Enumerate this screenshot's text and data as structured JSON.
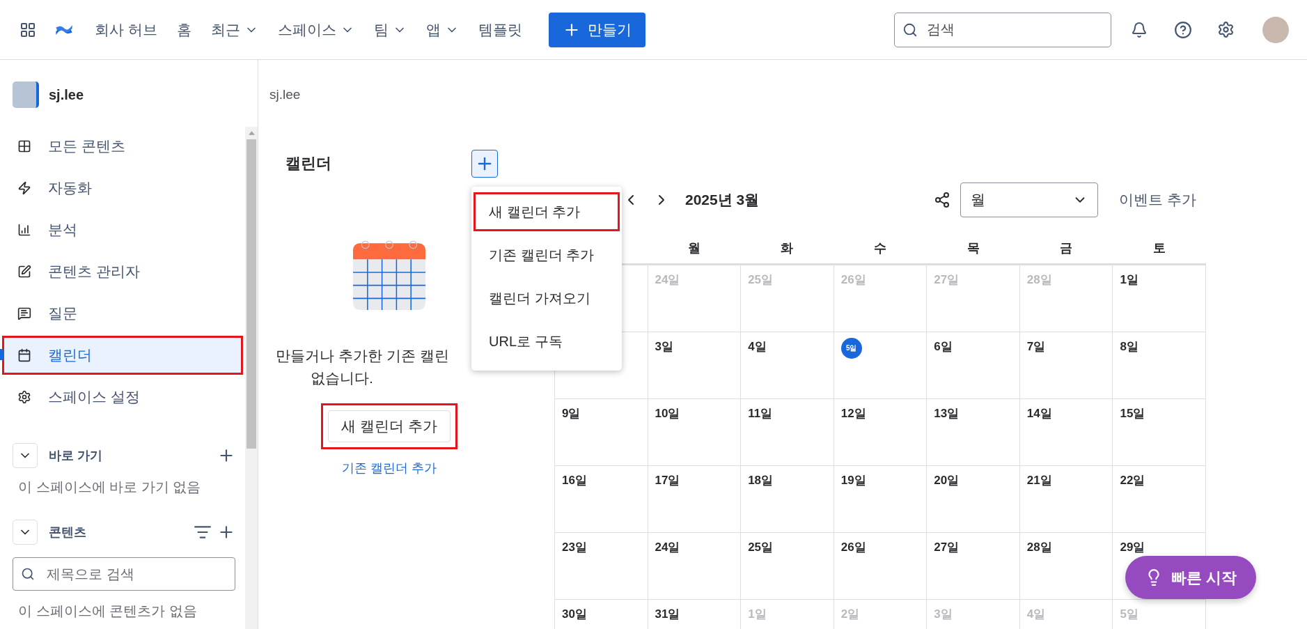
{
  "top_nav": {
    "items": [
      {
        "label": "회사 허브",
        "dropdown": false
      },
      {
        "label": "홈",
        "dropdown": false
      },
      {
        "label": "최근",
        "dropdown": true
      },
      {
        "label": "스페이스",
        "dropdown": true
      },
      {
        "label": "팀",
        "dropdown": true
      },
      {
        "label": "앱",
        "dropdown": true
      },
      {
        "label": "템플릿",
        "dropdown": false
      }
    ],
    "create_button": "만들기",
    "search": {
      "placeholder": "검색"
    }
  },
  "sidebar": {
    "space_name": "sj.lee",
    "items": [
      {
        "label": "모든 콘텐츠",
        "selected": false,
        "highlighted": false
      },
      {
        "label": "자동화",
        "selected": false,
        "highlighted": false
      },
      {
        "label": "분석",
        "selected": false,
        "highlighted": false
      },
      {
        "label": "콘텐츠 관리자",
        "selected": false,
        "highlighted": false
      },
      {
        "label": "질문",
        "selected": false,
        "highlighted": false
      },
      {
        "label": "캘린더",
        "selected": true,
        "highlighted": true
      },
      {
        "label": "스페이스 설정",
        "selected": false,
        "highlighted": false
      }
    ],
    "shortcuts": {
      "title": "바로 가기",
      "empty": "이 스페이스에 바로 가기 없음"
    },
    "content": {
      "title": "콘텐츠",
      "search_placeholder": "제목으로 검색",
      "empty": "이 스페이스에 콘텐츠가 없음"
    }
  },
  "breadcrumb": "sj.lee",
  "calendars": {
    "title": "캘린더",
    "add_menu": [
      {
        "label": "새 캘린더 추가",
        "highlighted": true
      },
      {
        "label": "기존 캘린더 추가",
        "highlighted": false
      },
      {
        "label": "캘린더 가져오기",
        "highlighted": false
      },
      {
        "label": "URL로 구독",
        "highlighted": false
      }
    ],
    "empty_message": [
      "만들거나 추가한 기존 캘린",
      "없습니다."
    ],
    "new_button": {
      "label": "새 캘린더 추가",
      "highlighted": true
    },
    "existing_link": "기존 캘린더 추가"
  },
  "calendar": {
    "month": "2025년 3월",
    "view": "월",
    "add_event": "이벤트 추가",
    "weekdays": [
      {
        "label": "월"
      },
      {
        "label": "화"
      },
      {
        "label": "수"
      },
      {
        "label": "목"
      },
      {
        "label": "금"
      },
      {
        "label": "토"
      }
    ],
    "weeks": [
      [
        {
          "day": "24일",
          "muted": true
        },
        {
          "day": "25일",
          "muted": true
        },
        {
          "day": "26일",
          "muted": true
        },
        {
          "day": "27일",
          "muted": true
        },
        {
          "day": "28일",
          "muted": true
        },
        {
          "day": "1일",
          "muted": false
        }
      ],
      [
        {
          "day": "3일",
          "muted": false
        },
        {
          "day": "4일",
          "muted": false
        },
        {
          "day": "5일",
          "today": true
        },
        {
          "day": "6일",
          "muted": false
        },
        {
          "day": "7일",
          "muted": false
        },
        {
          "day": "8일",
          "muted": false
        }
      ],
      [
        {
          "day": "9일",
          "muted": false
        },
        {
          "day": "10일",
          "muted": false
        },
        {
          "day": "11일",
          "muted": false
        },
        {
          "day": "12일",
          "muted": false
        },
        {
          "day": "13일",
          "muted": false
        },
        {
          "day": "14일",
          "muted": false
        },
        {
          "day": "15일",
          "muted": false
        }
      ],
      [
        {
          "day": "16일",
          "muted": false
        },
        {
          "day": "17일",
          "muted": false
        },
        {
          "day": "18일",
          "muted": false
        },
        {
          "day": "19일",
          "muted": false
        },
        {
          "day": "20일",
          "muted": false
        },
        {
          "day": "21일",
          "muted": false
        },
        {
          "day": "22일",
          "muted": false
        }
      ],
      [
        {
          "day": "23일",
          "muted": false
        },
        {
          "day": "24일",
          "muted": false
        },
        {
          "day": "25일",
          "muted": false
        },
        {
          "day": "26일",
          "muted": false
        },
        {
          "day": "27일",
          "muted": false
        },
        {
          "day": "28일",
          "muted": false
        },
        {
          "day": "29일",
          "muted": false
        }
      ],
      [
        {
          "day": "30일",
          "muted": false
        },
        {
          "day": "31일",
          "muted": false
        },
        {
          "day": "1일",
          "muted": true
        },
        {
          "day": "2일",
          "muted": true
        },
        {
          "day": "3일",
          "muted": true
        },
        {
          "day": "4일",
          "muted": true
        },
        {
          "day": "5일",
          "muted": true
        }
      ]
    ]
  },
  "quick_start": "빠른 시작"
}
